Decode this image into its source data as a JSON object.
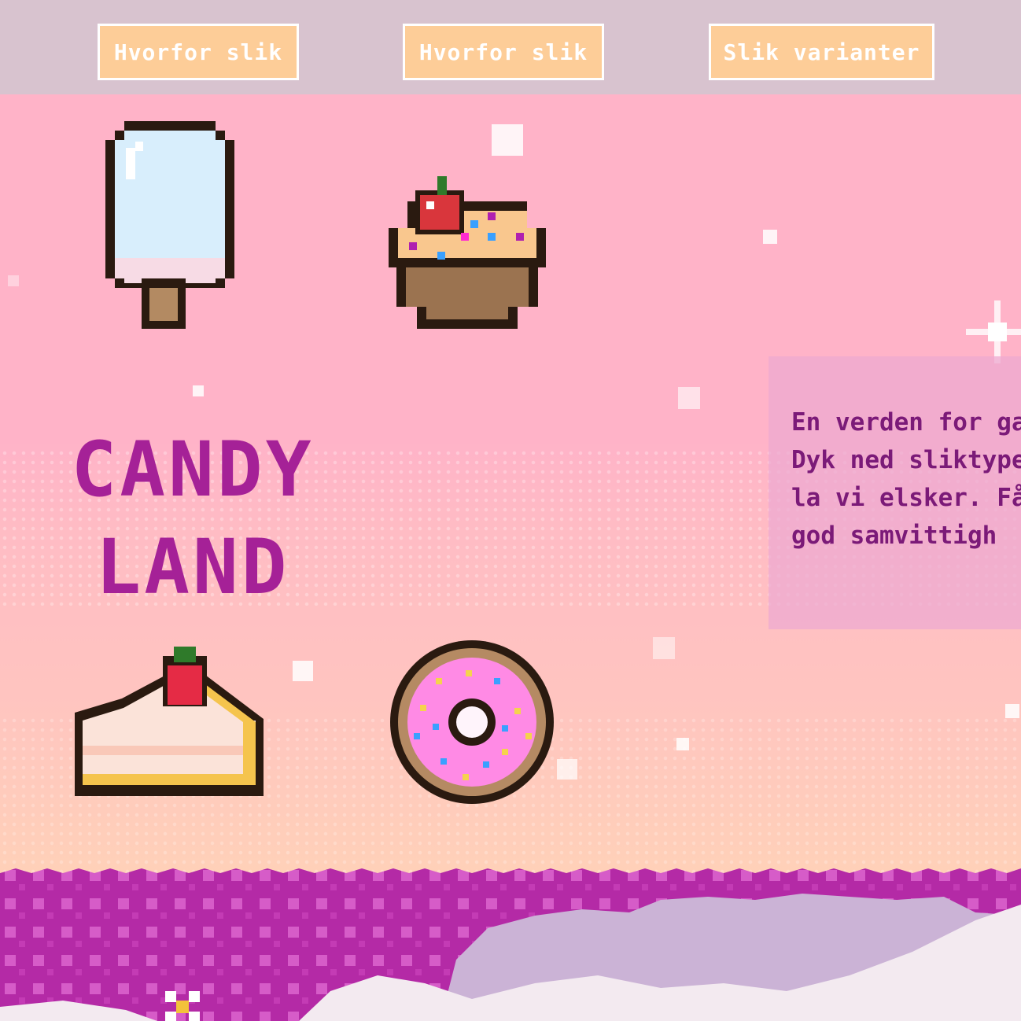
{
  "nav": {
    "buttons": [
      {
        "label": "Hvorfor slik"
      },
      {
        "label": "Hvorfor slik"
      },
      {
        "label": "Slik varianter"
      }
    ]
  },
  "hero": {
    "title_line1": "CANDY",
    "title_line2": "LAND"
  },
  "info": {
    "text": "En verden for ganen. Dyk ned sliktyper og la vi elsker. Få en god samvittigh"
  },
  "colors": {
    "nav_background": "#d8c3cf",
    "button_fill": "#fdcd98",
    "title": "#a52197",
    "info_text": "#7b1a78",
    "sky": "#ffb3c8"
  },
  "icons": [
    "popsicle-icon",
    "cupcake-icon",
    "cake-slice-icon",
    "donut-icon"
  ]
}
